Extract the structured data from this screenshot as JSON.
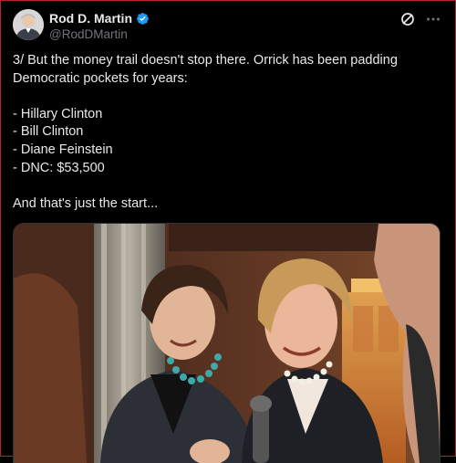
{
  "tweet": {
    "author": {
      "display_name": "Rod D. Martin",
      "handle": "@RodDMartin",
      "verified": true,
      "avatar_icon": "avatar-photo"
    },
    "actions": {
      "grok_icon": "slash-circle-icon",
      "more_icon": "more-horizontal-icon"
    },
    "text_lines": [
      "3/ But the money trail doesn't stop there. Orrick has been padding",
      "Democratic pockets for years:",
      "",
      "- Hillary Clinton",
      "- Bill Clinton",
      "- Diane Feinstein",
      "- DNC: $53,500",
      "",
      "And that's just the start..."
    ],
    "media": {
      "type": "photo"
    }
  },
  "colors": {
    "background": "#000000",
    "text": "#e7e9ea",
    "secondary_text": "#71767b",
    "verified_blue": "#1d9bf0",
    "frame_border": "#b3262b"
  }
}
